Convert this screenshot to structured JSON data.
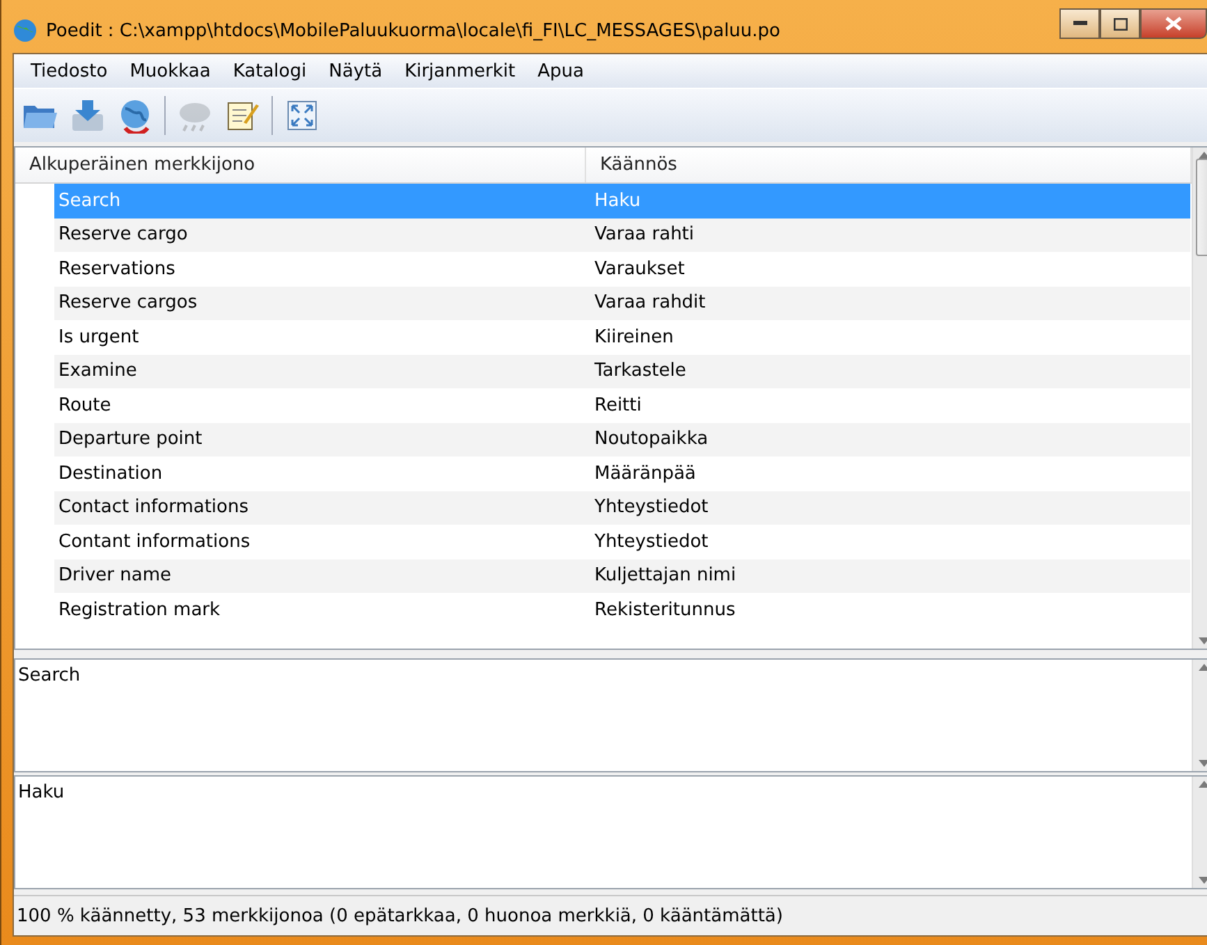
{
  "window": {
    "title": "Poedit : C:\\xampp\\htdocs\\MobilePaluukuorma\\locale\\fi_FI\\LC_MESSAGES\\paluu.po"
  },
  "menu": [
    "Tiedosto",
    "Muokkaa",
    "Katalogi",
    "Näytä",
    "Kirjanmerkit",
    "Apua"
  ],
  "toolbar": [
    {
      "kind": "open",
      "disabled": false
    },
    {
      "kind": "save",
      "disabled": false
    },
    {
      "kind": "update",
      "disabled": false
    },
    {
      "kind": "sep"
    },
    {
      "kind": "cloud",
      "disabled": true
    },
    {
      "kind": "comment",
      "disabled": false
    },
    {
      "kind": "sep"
    },
    {
      "kind": "fullscreen",
      "disabled": false
    }
  ],
  "table": {
    "columns": [
      "Alkuperäinen merkkijono",
      "Käännös"
    ],
    "rows": [
      {
        "source": "Search",
        "translation": "Haku",
        "selected": true
      },
      {
        "source": "Reserve cargo",
        "translation": "Varaa rahti",
        "selected": false
      },
      {
        "source": "Reservations",
        "translation": "Varaukset",
        "selected": false
      },
      {
        "source": "Reserve cargos",
        "translation": "Varaa rahdit",
        "selected": false
      },
      {
        "source": "Is urgent",
        "translation": "Kiireinen",
        "selected": false
      },
      {
        "source": "Examine",
        "translation": "Tarkastele",
        "selected": false
      },
      {
        "source": "Route",
        "translation": "Reitti",
        "selected": false
      },
      {
        "source": "Departure point",
        "translation": "Noutopaikka",
        "selected": false
      },
      {
        "source": "Destination",
        "translation": "Määränpää",
        "selected": false
      },
      {
        "source": "Contact informations",
        "translation": "Yhteystiedot",
        "selected": false
      },
      {
        "source": "Contant informations",
        "translation": "Yhteystiedot",
        "selected": false
      },
      {
        "source": "Driver name",
        "translation": "Kuljettajan nimi",
        "selected": false
      },
      {
        "source": "Registration mark",
        "translation": "Rekisteritunnus",
        "selected": false
      }
    ]
  },
  "source_text": "Search",
  "translation_text": "Haku",
  "status_bar": "100 % käännetty, 53 merkkijonoa (0 epätarkkaa, 0 huonoa merkkiä, 0 kääntämättä)"
}
